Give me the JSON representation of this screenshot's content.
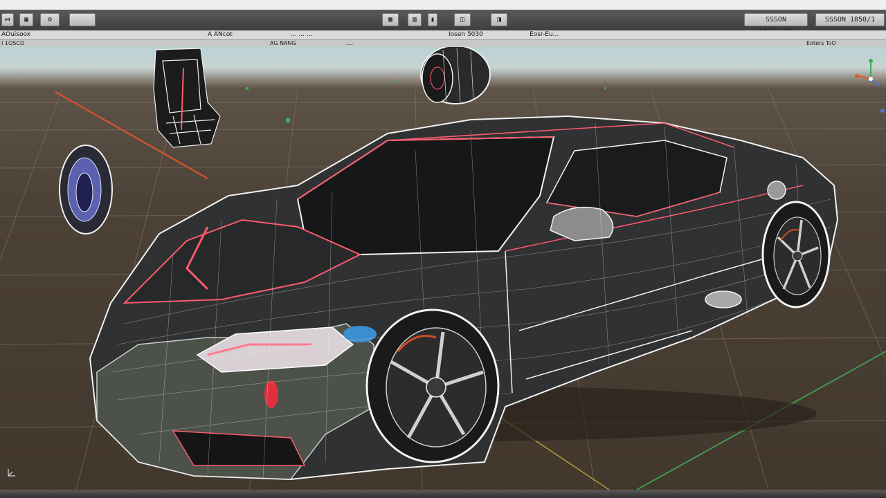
{
  "toolbar": {
    "buttons": [
      "⏯",
      "▣",
      "⚙"
    ],
    "btn_center1": "▦",
    "btn_center2": "▥",
    "btn_center3": "▮",
    "btn_center4": "◫",
    "btn_center5": "◨",
    "right_btn1": "SSSON 1003:100",
    "right_btn2": "SSSON 1850/1"
  },
  "header": {
    "title": "AOuisoox",
    "item1": "A ANcot",
    "item2": "... ... ...",
    "item3": "Iosen 5030",
    "item4": "Eosr-Eu..."
  },
  "subheader": {
    "left": "I 1OSCO",
    "mid1": "AG NANG",
    "mid2": "....",
    "right": "Eoters ToO"
  },
  "viewport": {
    "grid_color": "#8a7a6a",
    "mesh_color": "#f0f0f0",
    "seam_color": "#ff5a6e",
    "axis_x_color": "#e0552a",
    "axis_y_color": "#3c9a4a",
    "gizmo_icon": "axis-gizmo-icon",
    "corner_icon": "view-axes-icon"
  }
}
